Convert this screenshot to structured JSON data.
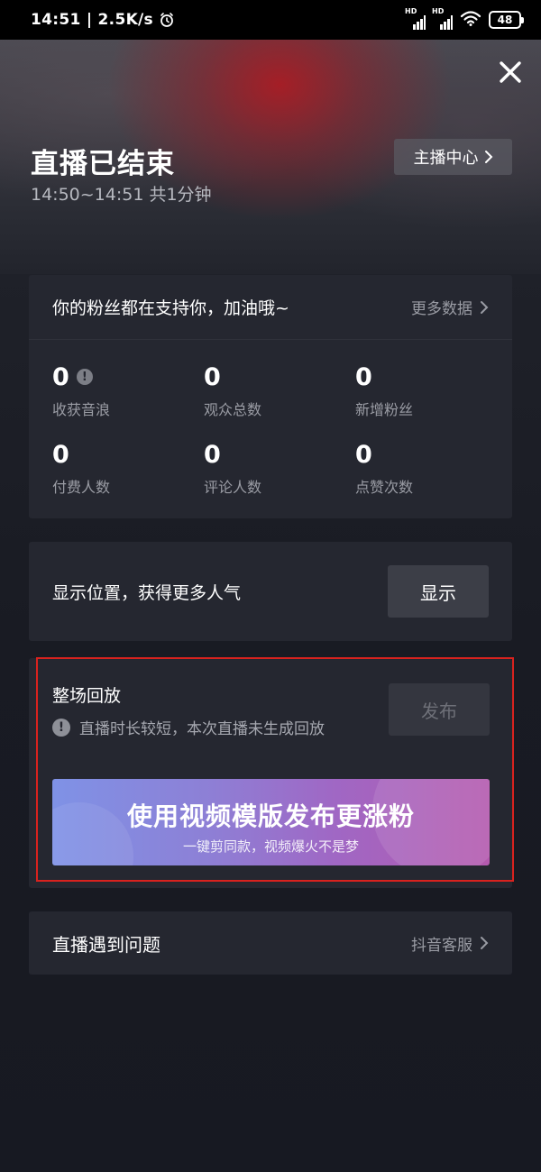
{
  "status_bar": {
    "time": "14:51 | 2.5K/s",
    "battery": "48",
    "icons": [
      "alarm-icon",
      "signal-hd-icon",
      "signal-hd-icon",
      "wifi-icon",
      "battery-icon"
    ],
    "hd_label": "HD"
  },
  "header": {
    "title": "直播已结束",
    "subtitle": "14:50~14:51 共1分钟",
    "host_center_label": "主播中心",
    "close_icon": "close-icon"
  },
  "fans_card": {
    "title": "你的粉丝都在支持你，加油哦~",
    "more_label": "更多数据",
    "stats": [
      {
        "value": "0",
        "label": "收获音浪",
        "has_info": true
      },
      {
        "value": "0",
        "label": "观众总数",
        "has_info": false
      },
      {
        "value": "0",
        "label": "新增粉丝",
        "has_info": false
      },
      {
        "value": "0",
        "label": "付费人数",
        "has_info": false
      },
      {
        "value": "0",
        "label": "评论人数",
        "has_info": false
      },
      {
        "value": "0",
        "label": "点赞次数",
        "has_info": false
      }
    ]
  },
  "location_card": {
    "text": "显示位置，获得更多人气",
    "button_label": "显示"
  },
  "replay_card": {
    "title": "整场回放",
    "note": "直播时长较短，本次直播未生成回放",
    "publish_label": "发布",
    "banner_title": "使用视频模版发布更涨粉",
    "banner_subtitle": "一键剪同款，视频爆火不是梦"
  },
  "problem_card": {
    "text": "直播遇到问题",
    "link_label": "抖音客服"
  },
  "colors": {
    "background": "#171922",
    "card": "#252730",
    "highlight_border": "#d8221e",
    "muted_text": "#9a9ca4"
  }
}
